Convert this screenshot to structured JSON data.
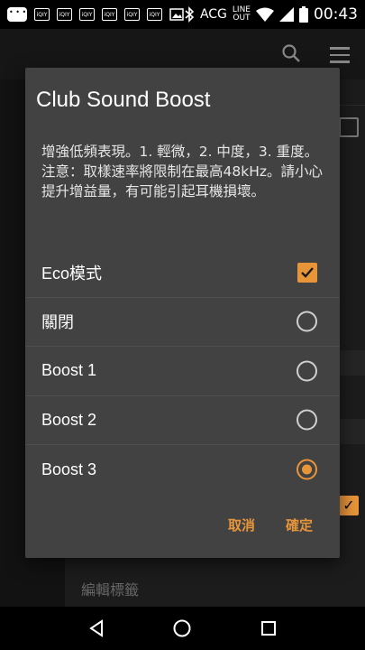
{
  "status_bar": {
    "app_icon_label": "iQIY",
    "acg_label": "ACG",
    "line_out": [
      "LINE",
      "OUT"
    ],
    "time": "00:43"
  },
  "background": {
    "edit_label": "編輯標籤"
  },
  "dialog": {
    "title": "Club Sound Boost",
    "message_line1": "增強低頻表現。1. 輕微，2. 中度，3. 重度。",
    "message_line2": "注意：取樣速率將限制在最高48kHz。請小心提升增益量，有可能引起耳機損壞。",
    "options": [
      {
        "label": "Eco模式",
        "control": "checkbox",
        "checked": true
      },
      {
        "label": "關閉",
        "control": "radio",
        "checked": false
      },
      {
        "label": "Boost 1",
        "control": "radio",
        "checked": false
      },
      {
        "label": "Boost 2",
        "control": "radio",
        "checked": false
      },
      {
        "label": "Boost 3",
        "control": "radio",
        "checked": true
      }
    ],
    "cancel_label": "取消",
    "ok_label": "確定"
  },
  "colors": {
    "accent": "#e8953a",
    "dialog_bg": "#424242"
  }
}
